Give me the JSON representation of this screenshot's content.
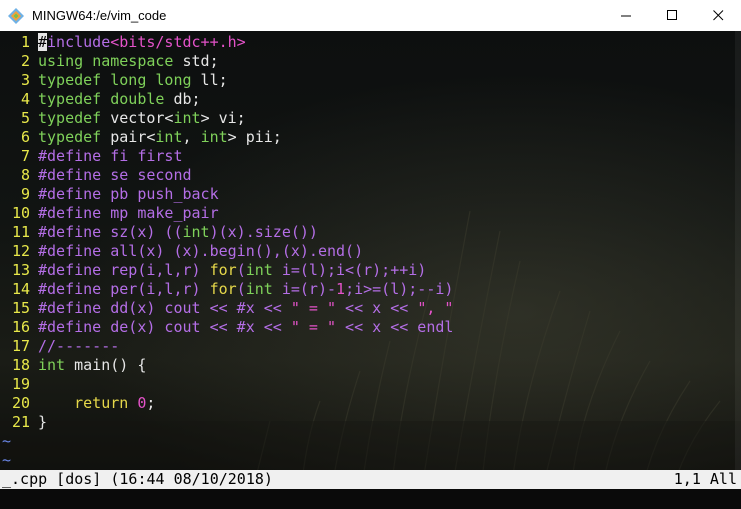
{
  "window": {
    "title": "MINGW64:/e/vim_code",
    "minimize_label": "─",
    "maximize_label": "☐",
    "close_label": "✕"
  },
  "editor": {
    "lines": [
      {
        "n": "1",
        "parts": [
          {
            "c": "cursor",
            "t": "#"
          },
          {
            "c": "pp",
            "t": "include"
          },
          {
            "c": "str",
            "t": "<bits/stdc++.h>"
          }
        ]
      },
      {
        "n": "2",
        "parts": [
          {
            "c": "kw",
            "t": "using"
          },
          {
            "c": "txt",
            "t": " "
          },
          {
            "c": "kw",
            "t": "namespace"
          },
          {
            "c": "txt",
            "t": " std;"
          }
        ]
      },
      {
        "n": "3",
        "parts": [
          {
            "c": "kw",
            "t": "typedef"
          },
          {
            "c": "txt",
            "t": " "
          },
          {
            "c": "kw",
            "t": "long"
          },
          {
            "c": "txt",
            "t": " "
          },
          {
            "c": "kw",
            "t": "long"
          },
          {
            "c": "txt",
            "t": " ll;"
          }
        ]
      },
      {
        "n": "4",
        "parts": [
          {
            "c": "kw",
            "t": "typedef"
          },
          {
            "c": "txt",
            "t": " "
          },
          {
            "c": "kw",
            "t": "double"
          },
          {
            "c": "txt",
            "t": " db;"
          }
        ]
      },
      {
        "n": "5",
        "parts": [
          {
            "c": "kw",
            "t": "typedef"
          },
          {
            "c": "txt",
            "t": " vector<"
          },
          {
            "c": "kw",
            "t": "int"
          },
          {
            "c": "txt",
            "t": "> vi;"
          }
        ]
      },
      {
        "n": "6",
        "parts": [
          {
            "c": "kw",
            "t": "typedef"
          },
          {
            "c": "txt",
            "t": " pair<"
          },
          {
            "c": "kw",
            "t": "int"
          },
          {
            "c": "txt",
            "t": ", "
          },
          {
            "c": "kw",
            "t": "int"
          },
          {
            "c": "txt",
            "t": "> pii;"
          }
        ]
      },
      {
        "n": "7",
        "parts": [
          {
            "c": "pp",
            "t": "#define fi first"
          }
        ]
      },
      {
        "n": "8",
        "parts": [
          {
            "c": "pp",
            "t": "#define se second"
          }
        ]
      },
      {
        "n": "9",
        "parts": [
          {
            "c": "pp",
            "t": "#define pb push_back"
          }
        ]
      },
      {
        "n": "10",
        "parts": [
          {
            "c": "pp",
            "t": "#define mp make_pair"
          }
        ]
      },
      {
        "n": "11",
        "parts": [
          {
            "c": "pp",
            "t": "#define sz(x) (("
          },
          {
            "c": "kw",
            "t": "int"
          },
          {
            "c": "pp",
            "t": ")(x).size())"
          }
        ]
      },
      {
        "n": "12",
        "parts": [
          {
            "c": "pp",
            "t": "#define all(x) (x).begin(),(x).end()"
          }
        ]
      },
      {
        "n": "13",
        "parts": [
          {
            "c": "pp",
            "t": "#define rep(i,l,r) "
          },
          {
            "c": "ctl",
            "t": "for"
          },
          {
            "c": "pp",
            "t": "("
          },
          {
            "c": "kw",
            "t": "int"
          },
          {
            "c": "pp",
            "t": " i=(l);i<(r);++i)"
          }
        ]
      },
      {
        "n": "14",
        "parts": [
          {
            "c": "pp",
            "t": "#define per(i,l,r) "
          },
          {
            "c": "ctl",
            "t": "for"
          },
          {
            "c": "pp",
            "t": "("
          },
          {
            "c": "kw",
            "t": "int"
          },
          {
            "c": "pp",
            "t": " i=(r)-"
          },
          {
            "c": "num",
            "t": "1"
          },
          {
            "c": "pp",
            "t": ";i>=(l);--i)"
          }
        ]
      },
      {
        "n": "15",
        "parts": [
          {
            "c": "pp",
            "t": "#define dd(x) cout << #x << "
          },
          {
            "c": "str",
            "t": "\" = \""
          },
          {
            "c": "pp",
            "t": " << x << "
          },
          {
            "c": "str",
            "t": "\", \""
          }
        ]
      },
      {
        "n": "16",
        "parts": [
          {
            "c": "pp",
            "t": "#define de(x) cout << #x << "
          },
          {
            "c": "str",
            "t": "\" = \""
          },
          {
            "c": "pp",
            "t": " << x << endl"
          }
        ]
      },
      {
        "n": "17",
        "parts": [
          {
            "c": "pp",
            "t": "//-------"
          }
        ]
      },
      {
        "n": "18",
        "parts": [
          {
            "c": "kw",
            "t": "int"
          },
          {
            "c": "txt",
            "t": " main() {"
          }
        ]
      },
      {
        "n": "19",
        "parts": []
      },
      {
        "n": "20",
        "parts": [
          {
            "c": "txt",
            "t": "    "
          },
          {
            "c": "ctl",
            "t": "return"
          },
          {
            "c": "txt",
            "t": " "
          },
          {
            "c": "num",
            "t": "0"
          },
          {
            "c": "txt",
            "t": ";"
          }
        ]
      },
      {
        "n": "21",
        "parts": [
          {
            "c": "txt",
            "t": "}"
          }
        ]
      }
    ],
    "tilde_lines": [
      "~",
      "~"
    ]
  },
  "statusbar": {
    "left": "_.cpp [dos] (16:44 08/10/2018)",
    "right": "1,1 All"
  },
  "colors": {
    "line_number": "#e8e84a",
    "keyword": "#7fd15a",
    "preprocessor": "#b46ee6",
    "string": "#e453c9",
    "tilde": "#6a86e6"
  }
}
